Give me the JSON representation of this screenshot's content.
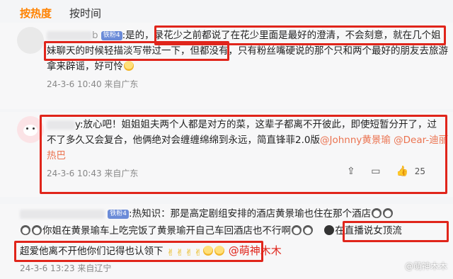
{
  "tabs": {
    "hot": "按热度",
    "time": "按时间"
  },
  "comments": [
    {
      "name_suffix": "b",
      "badge": "铁粉4",
      "prefix": ":是的，",
      "line1_boxed": "录花少之前都说了在花少里面是最好的澄清，不会刻意，就在几个姐",
      "line2_boxed": "妹聊天的时候轻描淡写带过一下，但都没有，",
      "line2_rest": "只有粉丝嘴硬说的那个只和两个最好的朋友去旅游",
      "line3": "拿来辟谣，好可怜",
      "meta": "24-3-6 10:40 来自广东"
    },
    {
      "line1": "y:放心吧！姐姐姐夫两个人都是对方的菜，这辈子都离不开彼此，即使短暂分开了，过",
      "line2_a": "不了多久又会复合，他俩绝对会缠缠绵绵到永远，简直锋菲2.0版",
      "line2_link": "@Johnny黄景瑜 @Dear-迪丽",
      "line3_link": "热巴",
      "meta": "24-3-6 10:43 来自广东",
      "likes": "25"
    },
    {
      "badge": "铁粉4",
      "line1": ":热知识：那是高定剧组安排的酒店黄景瑜也住在那个酒店",
      "line2_a": "你姐在黄景瑜车上吃完饭了黄景瑜开自己车回酒店也不行啊",
      "line2_boxed": "在直播说女顶流",
      "line3_boxed": "超爱他离不开他你们记得也认领下",
      "signature": "@萌神木木",
      "meta": "24-3-6 13:23 来自辽宁"
    }
  ],
  "watermark": "@萌神木木"
}
